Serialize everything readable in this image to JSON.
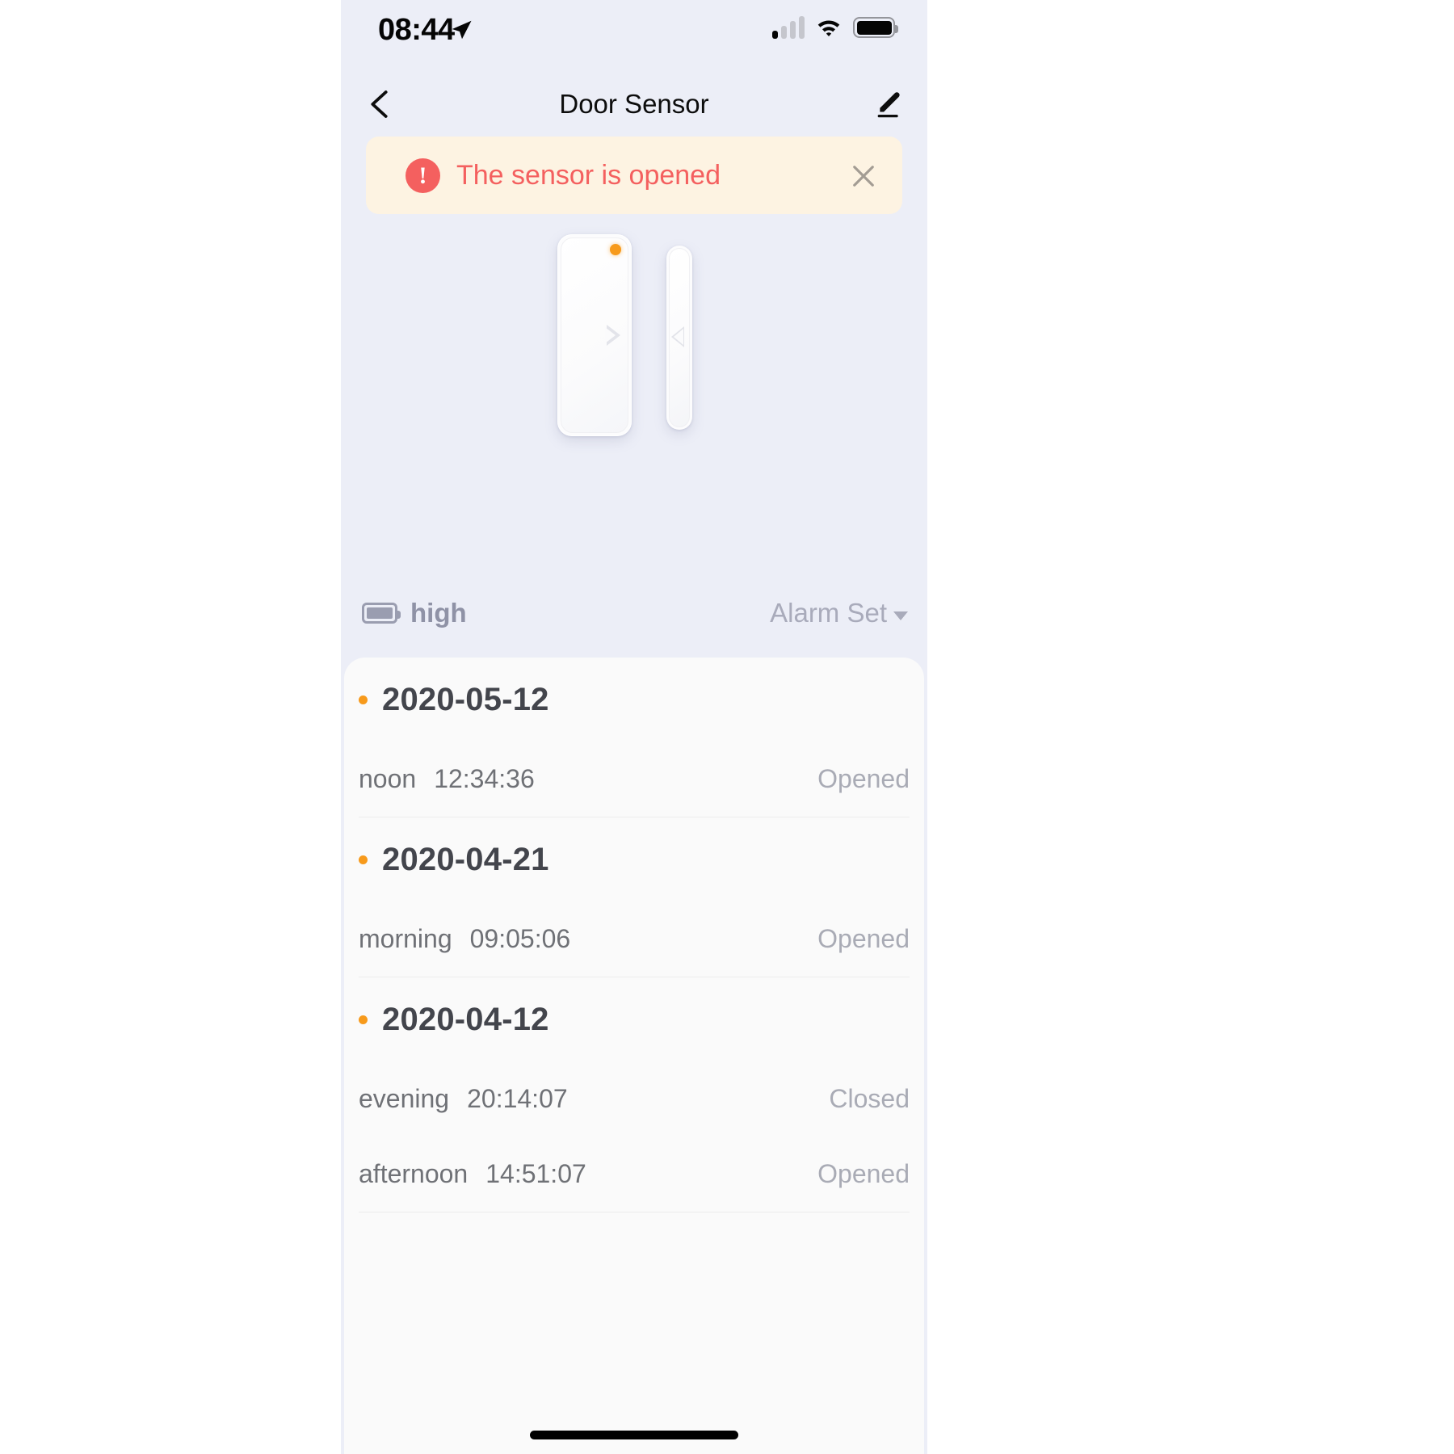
{
  "status_bar": {
    "time": "08:44",
    "location_icon": "location-arrow-icon",
    "signal_icon": "cellular-signal-icon",
    "signal_bars_filled": 1,
    "signal_bars_total": 4,
    "wifi_icon": "wifi-icon",
    "battery_icon": "battery-icon"
  },
  "nav": {
    "back_icon": "chevron-left-icon",
    "title": "Door Sensor",
    "edit_icon": "pencil-edit-icon"
  },
  "alert": {
    "icon": "exclamation-circle-icon",
    "icon_glyph": "!",
    "message": "The sensor is opened",
    "close_icon": "close-icon",
    "background_color": "#fdf3e2",
    "text_color": "#f4605f"
  },
  "device": {
    "main_body_name": "door-sensor-main-body",
    "magnet_name": "door-sensor-magnet-bar",
    "led_color": "#f79a1b",
    "led_name": "status-led-indicator"
  },
  "meta": {
    "battery_icon": "battery-level-icon",
    "battery_level": "high",
    "alarm_label": "Alarm Set",
    "alarm_caret_icon": "caret-down-icon"
  },
  "log": {
    "groups": [
      {
        "date": "2020-05-12",
        "entries": [
          {
            "period": "noon",
            "time": "12:34:36",
            "state": "Opened"
          }
        ]
      },
      {
        "date": "2020-04-21",
        "entries": [
          {
            "period": "morning",
            "time": "09:05:06",
            "state": "Opened"
          }
        ]
      },
      {
        "date": "2020-04-12",
        "entries": [
          {
            "period": "evening",
            "time": "20:14:07",
            "state": "Closed"
          },
          {
            "period": "afternoon",
            "time": "14:51:07",
            "state": "Opened"
          }
        ]
      }
    ]
  },
  "home_indicator": "home-indicator-bar"
}
